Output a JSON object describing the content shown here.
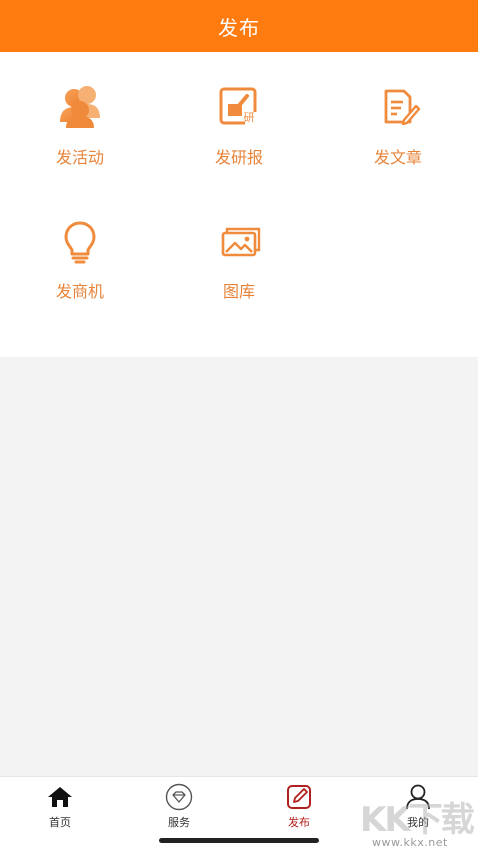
{
  "header": {
    "title": "发布"
  },
  "grid": [
    {
      "label": "发活动",
      "icon": "people-icon"
    },
    {
      "label": "发研报",
      "icon": "research-report-icon",
      "badge": "研"
    },
    {
      "label": "发文章",
      "icon": "article-edit-icon"
    },
    {
      "label": "发商机",
      "icon": "lightbulb-icon"
    },
    {
      "label": "图库",
      "icon": "gallery-icon"
    }
  ],
  "tabbar": [
    {
      "label": "首页",
      "icon": "home-icon",
      "active": false
    },
    {
      "label": "服务",
      "icon": "diamond-icon",
      "active": false
    },
    {
      "label": "发布",
      "icon": "edit-icon",
      "active": true
    },
    {
      "label": "我的",
      "icon": "user-icon",
      "active": false
    }
  ],
  "watermark": {
    "text": "KK下载",
    "url": "www.kkx.net"
  },
  "colors": {
    "accent": "#fe7b10",
    "icon": "#f08a3c",
    "active_tab": "#b0201e"
  }
}
